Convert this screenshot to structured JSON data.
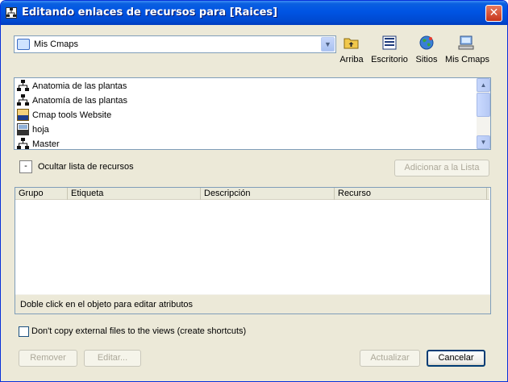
{
  "window": {
    "title": "Editando enlaces de recursos para [Raices]",
    "close_symbol": "✕"
  },
  "location": {
    "selected": "Mis Cmaps",
    "icon": "cmap-folder-icon"
  },
  "nav": [
    {
      "label": "Arriba",
      "icon": "folder-up-icon"
    },
    {
      "label": "Escritorio",
      "icon": "desktop-icon"
    },
    {
      "label": "Sitios",
      "icon": "globe-icon"
    },
    {
      "label": "Mis Cmaps",
      "icon": "computer-icon"
    }
  ],
  "resources": [
    {
      "label": "Anatomia de las plantas",
      "icon": "cmap-icon"
    },
    {
      "label": "Anatomía de las plantas",
      "icon": "cmap-icon"
    },
    {
      "label": "Cmap tools Website",
      "icon": "url-icon"
    },
    {
      "label": "hoja",
      "icon": "gif-icon"
    },
    {
      "label": "Master",
      "icon": "cmap-icon"
    }
  ],
  "toggle": {
    "symbol": "-",
    "label": "Ocultar lista de recursos"
  },
  "add_button": "Adicionar a la Lista",
  "table": {
    "columns": [
      "Grupo",
      "Etiqueta",
      "Descripción",
      "Recurso"
    ],
    "rows": [],
    "hint": "Doble click en el objeto para editar atributos"
  },
  "copy_option": {
    "label": "Don't copy external files to the views (create shortcuts)",
    "checked": false
  },
  "buttons": {
    "remove": "Remover",
    "edit": "Editar...",
    "update": "Actualizar",
    "cancel": "Cancelar"
  },
  "colors": {
    "titlebar": "#0054e3",
    "face": "#ece9d8",
    "border": "#7f9db9"
  }
}
